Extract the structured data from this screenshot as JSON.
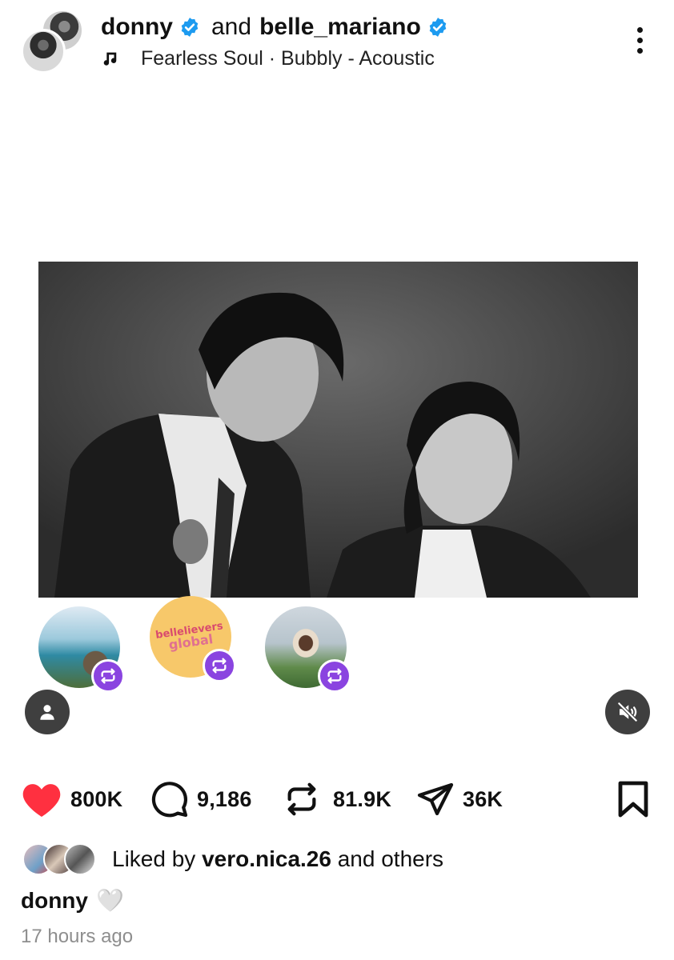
{
  "header": {
    "user1": "donny",
    "conjunction": "and",
    "user2": "belle_mariano",
    "music": "Fearless Soul · Bubbly - Acoustic",
    "music_icon": "music-note-icon",
    "more_icon": "more-vertical-icon"
  },
  "reposters": [
    {
      "name": "reposter-beach",
      "badge_icon": "repost-icon"
    },
    {
      "name": "reposter-bellelievers",
      "logo_text": "bellelievers",
      "logo_sub": "global",
      "badge_icon": "repost-icon"
    },
    {
      "name": "reposter-golf",
      "badge_icon": "repost-icon"
    }
  ],
  "actions": {
    "likes": "800K",
    "comments": "9,186",
    "reposts": "81.9K",
    "shares": "36K"
  },
  "liked_by": {
    "prefix": "Liked by",
    "user": "vero.nica.26",
    "suffix": "and others"
  },
  "caption": {
    "user": "donny",
    "emoji": "🤍"
  },
  "time": "17 hours ago",
  "colors": {
    "verified": "#1d9bf0",
    "like": "#ff3040",
    "repost_badge": "#8a44e0",
    "muted_text": "#8e8e8e"
  }
}
